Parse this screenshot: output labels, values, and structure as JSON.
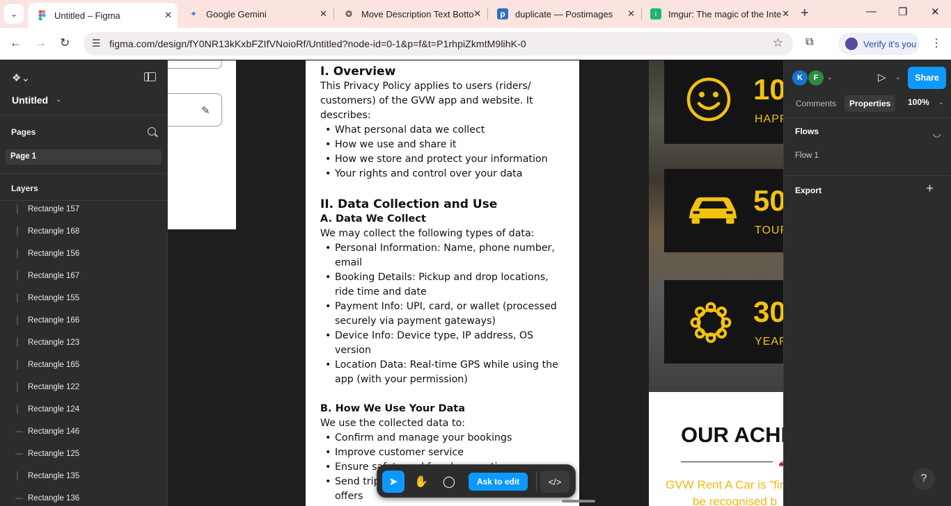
{
  "browser": {
    "tabs": [
      {
        "title": "Untitled – Figma",
        "favicon": "figma-icon",
        "active": true
      },
      {
        "title": "Google Gemini",
        "favicon": "gemini-icon",
        "active": false
      },
      {
        "title": "Move Description Text Botto",
        "favicon": "chatgpt-icon",
        "active": false
      },
      {
        "title": "duplicate — Postimages",
        "favicon": "postimages-icon",
        "active": false
      },
      {
        "title": "Imgur: The magic of the Inte",
        "favicon": "imgur-icon",
        "active": false
      }
    ],
    "url": "figma.com/design/fY0NR13kKxbFZIfVNoioRf/Untitled?node-id=0-1&p=f&t=P1rhpiZkmtM9lihK-0",
    "verify_label": "Verify it's you"
  },
  "left_panel": {
    "file_name": "Untitled",
    "pages_heading": "Pages",
    "current_page": "Page 1",
    "layers_heading": "Layers",
    "layers": [
      {
        "name": "Rectangle 157",
        "icon": "rectangle-layer-icon"
      },
      {
        "name": "Rectangle 168",
        "icon": "rectangle-layer-icon"
      },
      {
        "name": "Rectangle 156",
        "icon": "rectangle-layer-icon"
      },
      {
        "name": "Rectangle 167",
        "icon": "rectangle-layer-icon"
      },
      {
        "name": "Rectangle 155",
        "icon": "rectangle-layer-icon"
      },
      {
        "name": "Rectangle 166",
        "icon": "rectangle-layer-icon"
      },
      {
        "name": "Rectangle 123",
        "icon": "rectangle-layer-icon"
      },
      {
        "name": "Rectangle 165",
        "icon": "rectangle-layer-icon"
      },
      {
        "name": "Rectangle 122",
        "icon": "rectangle-layer-icon"
      },
      {
        "name": "Rectangle 124",
        "icon": "rectangle-layer-icon"
      },
      {
        "name": "Rectangle 146",
        "icon": "line-layer-icon"
      },
      {
        "name": "Rectangle 125",
        "icon": "line-layer-icon"
      },
      {
        "name": "Rectangle 135",
        "icon": "rectangle-layer-icon"
      },
      {
        "name": "Rectangle 136",
        "icon": "line-layer-icon"
      }
    ]
  },
  "document": {
    "overview_heading": "I. Overview",
    "overview_text": "This Privacy Policy applies to users (riders/ customers) of the GVW app and website. It describes:",
    "overview_items": [
      "What personal data we collect",
      "How we use and share it",
      "How we store and protect your information",
      "Your rights and control over your data"
    ],
    "collection_heading": "II. Data Collection and Use",
    "collect_subheading": "A. Data We Collect",
    "collect_intro": "We may collect the following types of data:",
    "collect_items": [
      "Personal Information: Name, phone number, email",
      "Booking Details: Pickup and drop locations, ride time and date",
      "Payment Info: UPI, card, or wallet (processed securely via payment gateways)",
      "Device Info: Device type, IP address, OS version",
      "Location Data: Real-time GPS while using the app (with your permission)"
    ],
    "use_subheading": "B. How We Use Your Data",
    "use_intro": "We use the collected data to:",
    "use_items": [
      "Confirm and manage your bookings",
      "Improve customer service",
      "Ensure safety and fraud prevention",
      "Send trip updates, alerts, and promotional offers"
    ]
  },
  "design_preview": {
    "stats": [
      {
        "number": "10",
        "label": "HAPP",
        "icon": "smiley-icon"
      },
      {
        "number": "50",
        "label": "TOUR",
        "icon": "car-icon"
      },
      {
        "number": "30",
        "label": "YEAR",
        "icon": "badge-icon"
      }
    ],
    "achievements_title": "OUR ACHI",
    "achievements_line1": "GVW Rent A Car is \"fir",
    "achievements_line2": "be recognised b",
    "accent_color": "#f2c20f"
  },
  "toolbar": {
    "ask_label": "Ask to edit",
    "code_label": "</>"
  },
  "right_panel": {
    "avatars": [
      {
        "initial": "K",
        "color": "#1a73c9"
      },
      {
        "initial": "F",
        "color": "#2e8b3e"
      }
    ],
    "share_label": "Share",
    "tabs": [
      "Comments",
      "Properties"
    ],
    "active_tab": "Properties",
    "zoom": "100%",
    "flows_heading": "Flows",
    "flow_item": "Flow 1",
    "export_heading": "Export",
    "help_label": "?"
  }
}
